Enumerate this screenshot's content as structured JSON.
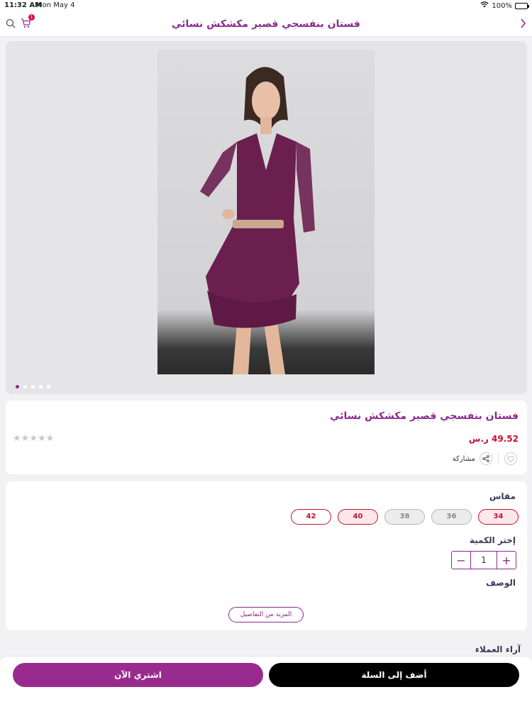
{
  "status_bar": {
    "time": "11:32 AM",
    "date": "Mon May 4",
    "battery": "100%"
  },
  "navbar": {
    "title": "فستان بنفسجي قصير مكشكش نسائي",
    "cart_count": "1"
  },
  "gallery": {
    "slide_count": 5,
    "active_slide": 0
  },
  "product": {
    "title": "فستان بنفسجي قصير مكشكش نسائي",
    "price": "49.52 ر.س",
    "rating_stars": "★★★★★",
    "share_label": "مشاركة"
  },
  "options": {
    "size_label": "مقاس",
    "sizes": [
      {
        "label": "34",
        "state": "selected"
      },
      {
        "label": "36",
        "state": "unavailable"
      },
      {
        "label": "38",
        "state": "unavailable"
      },
      {
        "label": "40",
        "state": "selected"
      },
      {
        "label": "42",
        "state": "available"
      }
    ],
    "quantity_label": "إختر الكمية",
    "quantity": "1",
    "description_label": "الوصف",
    "more_details": "المزيد من التفاصيل"
  },
  "reviews_label": "آراء العملاء",
  "actions": {
    "add_to_cart": "أضف إلى السلة",
    "buy_now": "اشتري الآن"
  },
  "colors": {
    "brand": "#8c2a8c",
    "price": "#c8102e",
    "dress": "#6b1f4f"
  }
}
